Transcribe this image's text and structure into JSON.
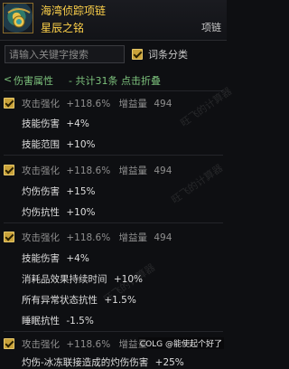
{
  "item": {
    "name": "海湾侦踪项链",
    "subtitle": "星辰之铭",
    "slot": "项链"
  },
  "search": {
    "placeholder": "请输入关键字搜索",
    "entry_classify_label": "词条分类",
    "entry_classify_checked": true
  },
  "group": {
    "arrow": "<",
    "label": "伤害属性",
    "summary": "- 共计31条 点击折叠"
  },
  "entries": [
    {
      "header": {
        "name": "攻击强化",
        "value": "+118.6%",
        "gain_label": "增益量",
        "gain_value": "494"
      },
      "lines": [
        {
          "label": "技能伤害",
          "value": "+4%"
        },
        {
          "label": "技能范围",
          "value": "+10%"
        }
      ]
    },
    {
      "header": {
        "name": "攻击强化",
        "value": "+118.6%",
        "gain_label": "增益量",
        "gain_value": "494"
      },
      "lines": [
        {
          "label": "灼伤伤害",
          "value": "+15%"
        },
        {
          "label": "灼伤抗性",
          "value": "+10%"
        }
      ]
    },
    {
      "header": {
        "name": "攻击强化",
        "value": "+118.6%",
        "gain_label": "增益量",
        "gain_value": "494"
      },
      "lines": [
        {
          "label": "技能伤害",
          "value": "+4%"
        },
        {
          "label": "消耗品效果持续时间",
          "value": "+10%"
        },
        {
          "label": "所有异常状态抗性",
          "value": "+1.5%"
        },
        {
          "label": "睡眠抗性",
          "value": "-1.5%"
        }
      ]
    },
    {
      "header": {
        "name": "攻击强化",
        "value": "+118.6%",
        "gain_label": "增益量",
        "gain_value": ""
      },
      "lines": [
        {
          "label": "灼伤-冰冻联接造成的灼伤伤害",
          "value": "+25%"
        }
      ]
    }
  ],
  "watermark": {
    "text": "旺飞的计算器",
    "corner": "COLG @能使起个好了"
  }
}
